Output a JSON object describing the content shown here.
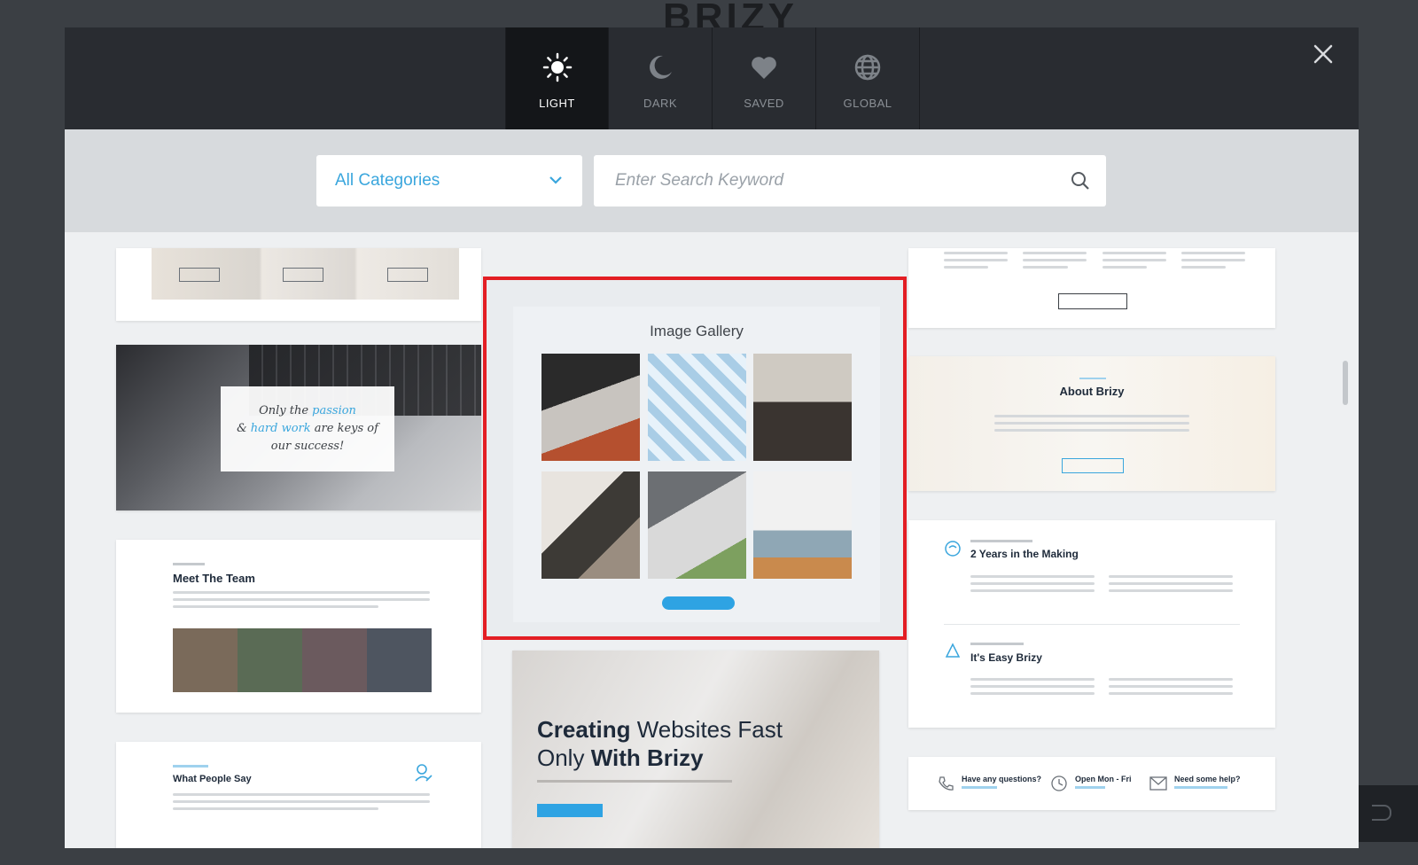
{
  "background": {
    "brand": "BRIZY"
  },
  "tabs": [
    {
      "label": "LIGHT",
      "icon": "sun-icon",
      "active": true
    },
    {
      "label": "DARK",
      "icon": "moon-icon"
    },
    {
      "label": "SAVED",
      "icon": "heart-icon"
    },
    {
      "label": "GLOBAL",
      "icon": "globe-icon"
    }
  ],
  "toolbar": {
    "category": "All Categories",
    "search_placeholder": "Enter Search Keyword"
  },
  "cards": {
    "quote": {
      "line1a": "Only the ",
      "line1b": "passion",
      "line2a": "& ",
      "line2b": "hard work",
      "line2c": " are keys of",
      "line3": "our success!"
    },
    "team": {
      "title": "Meet The Team"
    },
    "testimonials": {
      "title": "What People Say"
    },
    "gallery": {
      "title": "Image Gallery"
    },
    "hero": {
      "title_bold1": "Creating",
      "title_rest1": " Websites Fast",
      "title_rest2": "Only ",
      "title_bold2": "With Brizy"
    },
    "about": {
      "title": "About Brizy"
    },
    "features": {
      "item1": "2 Years in the Making",
      "item2": "It's Easy Brizy"
    },
    "contact": {
      "item1": "Have any questions?",
      "item2": "Open Mon - Fri",
      "item3": "Need some help?"
    }
  },
  "colors": {
    "accent": "#3aa6dd",
    "highlight": "#e31e24",
    "header": "#292c31"
  }
}
